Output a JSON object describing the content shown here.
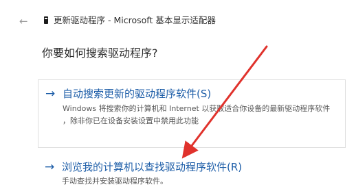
{
  "header": {
    "back_glyph": "←",
    "icon": "device-icon",
    "title": "更新驱动程序 - Microsoft 基本显示适配器"
  },
  "question": "你要如何搜索驱动程序?",
  "options": [
    {
      "arrow": "→",
      "title": "自动搜索更新的驱动程序软件(S)",
      "desc_line1": "Windows 将搜索你的计算机和 Internet 以获取适合你设备的最新驱动程序软件",
      "desc_line2": "，除非你已在设备安装设置中禁用此功能"
    },
    {
      "arrow": "→",
      "title": "浏览我的计算机以查找驱动程序软件(R)",
      "desc_line1": "手动查找并安装驱动程序软件。"
    }
  ],
  "annotation": {
    "color": "#e0322c"
  }
}
